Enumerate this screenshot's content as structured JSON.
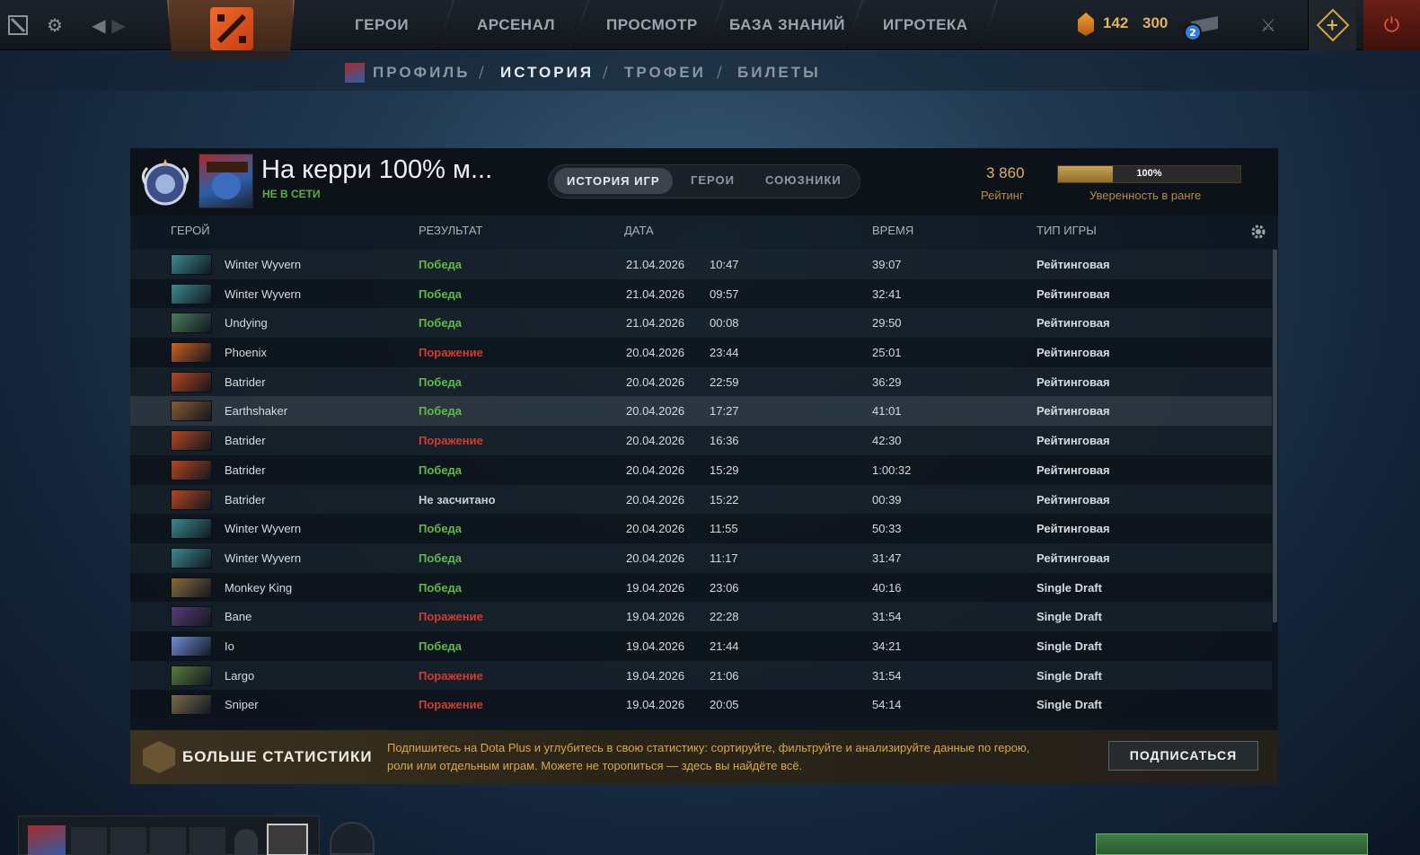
{
  "topbar": {
    "nav": [
      "ГЕРОИ",
      "АРСЕНАЛ",
      "ПРОСМОТР",
      "БАЗА ЗНАНИЙ",
      "ИГРОТЕКА"
    ],
    "shards": "142",
    "tokens": "300",
    "notifications": "2"
  },
  "subnav": {
    "items": [
      "ПРОФИЛЬ",
      "ИСТОРИЯ",
      "ТРОФЕИ",
      "БИЛЕТЫ"
    ],
    "active": "ИСТОРИЯ"
  },
  "profile": {
    "name": "На керри 100% м...",
    "status": "НЕ В СЕТИ",
    "tabs": [
      "ИСТОРИЯ ИГР",
      "ГЕРОИ",
      "СОЮЗНИКИ"
    ],
    "rating_value": "3 860",
    "rating_label": "Рейтинг",
    "confidence_value": "100%",
    "confidence_fraction": 1.0,
    "confidence_label": "Уверенность в ранге"
  },
  "table": {
    "headers": [
      "ГЕРОЙ",
      "РЕЗУЛЬТАТ",
      "ДАТА",
      "ВРЕМЯ",
      "ТИП ИГРЫ"
    ],
    "rows": [
      {
        "hero": "Winter Wyvern",
        "result": "Победа",
        "kind": "win",
        "date": "21.04.2026",
        "time": "10:47",
        "duration": "39:07",
        "type": "Рейтинговая",
        "color": "#3b8a8f"
      },
      {
        "hero": "Winter Wyvern",
        "result": "Победа",
        "kind": "win",
        "date": "21.04.2026",
        "time": "09:57",
        "duration": "32:41",
        "type": "Рейтинговая",
        "color": "#3b8a8f"
      },
      {
        "hero": "Undying",
        "result": "Победа",
        "kind": "win",
        "date": "21.04.2026",
        "time": "00:08",
        "duration": "29:50",
        "type": "Рейтинговая",
        "color": "#4c7a5c"
      },
      {
        "hero": "Phoenix",
        "result": "Поражение",
        "kind": "loss",
        "date": "20.04.2026",
        "time": "23:44",
        "duration": "25:01",
        "type": "Рейтинговая",
        "color": "#d0601e"
      },
      {
        "hero": "Batrider",
        "result": "Победа",
        "kind": "win",
        "date": "20.04.2026",
        "time": "22:59",
        "duration": "36:29",
        "type": "Рейтинговая",
        "color": "#b5461e"
      },
      {
        "hero": "Earthshaker",
        "result": "Победа",
        "kind": "win",
        "date": "20.04.2026",
        "time": "17:27",
        "duration": "41:01",
        "type": "Рейтинговая",
        "color": "#8a5a2e"
      },
      {
        "hero": "Batrider",
        "result": "Поражение",
        "kind": "loss",
        "date": "20.04.2026",
        "time": "16:36",
        "duration": "42:30",
        "type": "Рейтинговая",
        "color": "#b5461e"
      },
      {
        "hero": "Batrider",
        "result": "Победа",
        "kind": "win",
        "date": "20.04.2026",
        "time": "15:29",
        "duration": "1:00:32",
        "type": "Рейтинговая",
        "color": "#b5461e"
      },
      {
        "hero": "Batrider",
        "result": "Не засчитано",
        "kind": "none",
        "date": "20.04.2026",
        "time": "15:22",
        "duration": "00:39",
        "type": "Рейтинговая",
        "color": "#b5461e"
      },
      {
        "hero": "Winter Wyvern",
        "result": "Победа",
        "kind": "win",
        "date": "20.04.2026",
        "time": "11:55",
        "duration": "50:33",
        "type": "Рейтинговая",
        "color": "#3b8a8f"
      },
      {
        "hero": "Winter Wyvern",
        "result": "Победа",
        "kind": "win",
        "date": "20.04.2026",
        "time": "11:17",
        "duration": "31:47",
        "type": "Рейтинговая",
        "color": "#3b8a8f"
      },
      {
        "hero": "Monkey King",
        "result": "Победа",
        "kind": "win",
        "date": "19.04.2026",
        "time": "23:06",
        "duration": "40:16",
        "type": "Single Draft",
        "color": "#8c6a3a"
      },
      {
        "hero": "Bane",
        "result": "Поражение",
        "kind": "loss",
        "date": "19.04.2026",
        "time": "22:28",
        "duration": "31:54",
        "type": "Single Draft",
        "color": "#5b3a7a"
      },
      {
        "hero": "Io",
        "result": "Победа",
        "kind": "win",
        "date": "19.04.2026",
        "time": "21:44",
        "duration": "34:21",
        "type": "Single Draft",
        "color": "#6f8fd8"
      },
      {
        "hero": "Largo",
        "result": "Поражение",
        "kind": "loss",
        "date": "19.04.2026",
        "time": "21:06",
        "duration": "31:54",
        "type": "Single Draft",
        "color": "#5a7a3a"
      },
      {
        "hero": "Sniper",
        "result": "Поражение",
        "kind": "loss",
        "date": "19.04.2026",
        "time": "20:05",
        "duration": "54:14",
        "type": "Single Draft",
        "color": "#7a6a4a"
      }
    ],
    "highlighted_row": 5
  },
  "promo": {
    "title": "БОЛЬШЕ СТАТИСТИКИ",
    "text": "Подпишитесь на Dota Plus и углубитесь в свою статистику: сортируйте, фильтруйте и анализируйте данные по герою, роли или отдельным играм. Можете не торопиться — здесь вы найдёте всё.",
    "button": "ПОДПИСАТЬСЯ"
  }
}
